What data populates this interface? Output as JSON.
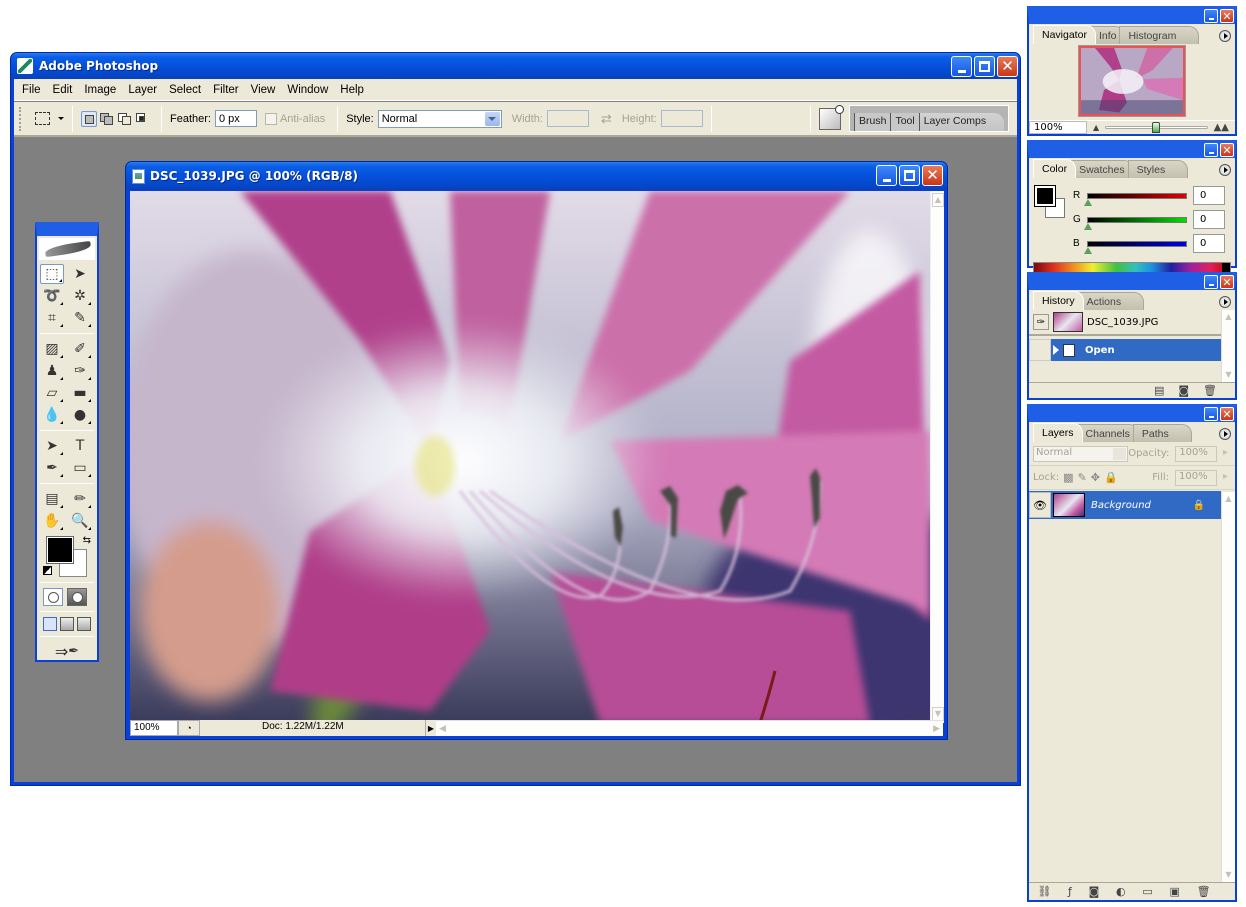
{
  "app": {
    "title": "Adobe Photoshop",
    "menu": [
      "File",
      "Edit",
      "Image",
      "Layer",
      "Select",
      "Filter",
      "View",
      "Window",
      "Help"
    ]
  },
  "options_bar": {
    "feather_label": "Feather:",
    "feather_value": "0 px",
    "antialias_label": "Anti-alias",
    "antialias_checked": false,
    "style_label": "Style:",
    "style_value": "Normal",
    "width_label": "Width:",
    "width_value": "",
    "height_label": "Height:",
    "height_value": "",
    "palette_well_tabs": [
      "Brush",
      "Tool",
      "Layer Comps"
    ]
  },
  "toolbox": {
    "tools": [
      {
        "name": "rectangular-marquee",
        "glyph": "⬚",
        "active": true
      },
      {
        "name": "move",
        "glyph": "➤"
      },
      {
        "name": "lasso",
        "glyph": "➰"
      },
      {
        "name": "magic-wand",
        "glyph": "✲"
      },
      {
        "name": "crop",
        "glyph": "⌗"
      },
      {
        "name": "slice",
        "glyph": "✎"
      },
      {
        "name": "healing-brush",
        "glyph": "▨"
      },
      {
        "name": "brush",
        "glyph": "✐"
      },
      {
        "name": "clone-stamp",
        "glyph": "♟"
      },
      {
        "name": "history-brush",
        "glyph": "✑"
      },
      {
        "name": "eraser",
        "glyph": "▱"
      },
      {
        "name": "gradient",
        "glyph": "▬"
      },
      {
        "name": "blur",
        "glyph": "💧"
      },
      {
        "name": "dodge",
        "glyph": "●"
      },
      {
        "name": "path-selection",
        "glyph": "➤"
      },
      {
        "name": "type",
        "glyph": "T"
      },
      {
        "name": "pen",
        "glyph": "✒"
      },
      {
        "name": "rectangle-shape",
        "glyph": "▭"
      },
      {
        "name": "notes",
        "glyph": "▤"
      },
      {
        "name": "eyedropper",
        "glyph": "✏"
      },
      {
        "name": "hand",
        "glyph": "✋"
      },
      {
        "name": "zoom",
        "glyph": "🔍"
      }
    ],
    "foreground_color": "#000000",
    "background_color": "#ffffff"
  },
  "document": {
    "title": "DSC_1039.JPG @ 100% (RGB/8)",
    "zoom": "100%",
    "doc_info": "Doc: 1.22M/1.22M"
  },
  "navigator": {
    "tabs": [
      "Navigator",
      "Info",
      "Histogram"
    ],
    "active_tab": "Navigator",
    "zoom": "100%",
    "zoom_slider_fraction": 0.5
  },
  "color": {
    "tabs": [
      "Color",
      "Swatches",
      "Styles"
    ],
    "active_tab": "Color",
    "channels": [
      {
        "label": "R",
        "value": "0",
        "bar_color": "#e00000"
      },
      {
        "label": "G",
        "value": "0",
        "bar_color": "#00e000"
      },
      {
        "label": "B",
        "value": "0",
        "bar_color": "#0000e0"
      }
    ]
  },
  "history": {
    "tabs": [
      "History",
      "Actions"
    ],
    "active_tab": "History",
    "snapshot": "DSC_1039.JPG",
    "states": [
      {
        "label": "Open",
        "selected": true
      }
    ]
  },
  "layers": {
    "tabs": [
      "Layers",
      "Channels",
      "Paths"
    ],
    "active_tab": "Layers",
    "blend_mode": "Normal",
    "opacity_label": "Opacity:",
    "opacity": "100%",
    "lock_label": "Lock:",
    "fill_label": "Fill:",
    "fill": "100%",
    "items": [
      {
        "name": "Background",
        "visible": true,
        "locked": true,
        "selected": true
      }
    ]
  },
  "colors": {
    "title_bar": "#0550dc",
    "workspace": "#808080",
    "panel_bg": "#ece9d8",
    "selection": "#316ac5"
  }
}
